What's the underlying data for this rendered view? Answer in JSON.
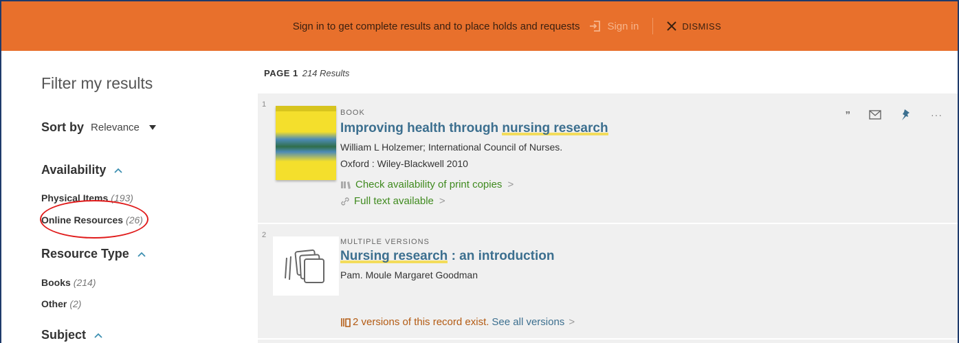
{
  "banner": {
    "message": "Sign in to get complete results and to place holds and requests",
    "signin_label": "Sign in",
    "dismiss_label": "DISMISS",
    "bg_color": "#e8702c"
  },
  "filters": {
    "title": "Filter my results",
    "sort_label": "Sort by",
    "sort_value": "Relevance",
    "availability": {
      "heading": "Availability",
      "items": [
        {
          "label": "Physical Items",
          "count": "(193)"
        },
        {
          "label": "Online Resources",
          "count": "(26)"
        }
      ]
    },
    "resource_type": {
      "heading": "Resource Type",
      "items": [
        {
          "label": "Books",
          "count": "(214)"
        },
        {
          "label": "Other",
          "count": "(2)"
        }
      ]
    },
    "subject": {
      "heading": "Subject"
    }
  },
  "results": {
    "page_label": "PAGE 1",
    "results_count": "214 Results",
    "items": [
      {
        "number": "1",
        "type": "BOOK",
        "title_highlight_pre": "Improving health through ",
        "title_highlight": "nursing research",
        "title_post": "",
        "author": "William L Holzemer; International Council of Nurses.",
        "publisher": "Oxford : Wiley-Blackwell 2010",
        "availability_print": "Check availability of print copies",
        "availability_online": "Full text available"
      },
      {
        "number": "2",
        "type": "MULTIPLE VERSIONS",
        "title_highlight": "Nursing research",
        "title_post": " : an introduction",
        "author": "Pam. Moule Margaret Goodman",
        "versions_text": "2 versions of this record exist.",
        "versions_link": "See all versions"
      }
    ]
  },
  "icons": {
    "actions": [
      "quote-icon",
      "email-icon",
      "pin-icon",
      "more-icon"
    ]
  }
}
